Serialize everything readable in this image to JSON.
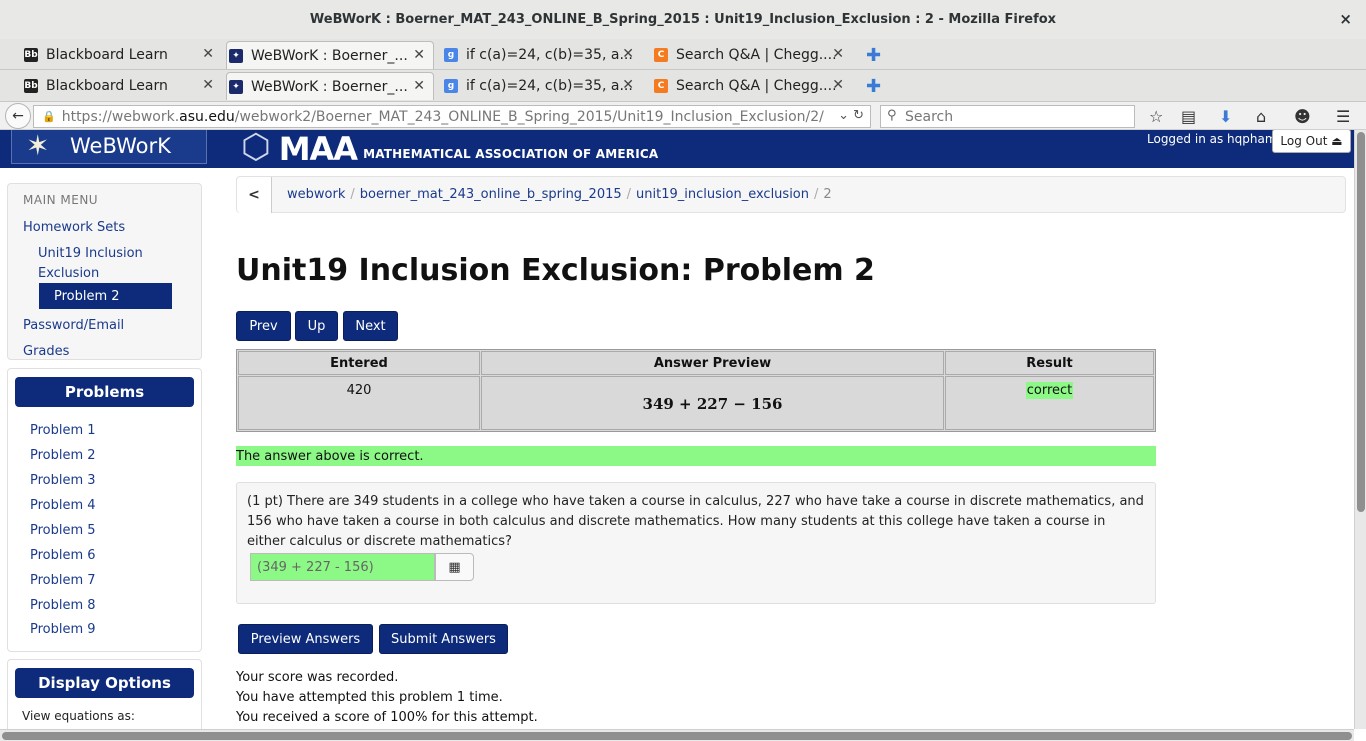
{
  "window": {
    "title": "WeBWorK : Boerner_MAT_243_ONLINE_B_Spring_2015 : Unit19_Inclusion_Exclusion : 2 - Mozilla Firefox",
    "close": "×"
  },
  "tabs": [
    {
      "label": "Blackboard Learn",
      "fav": "Bb"
    },
    {
      "label": "WeBWorK : Boerner_...",
      "fav": "✦"
    },
    {
      "label": "if c(a)=24, c(b)=35, a...",
      "fav": "g"
    },
    {
      "label": "Search Q&A | Chegg....",
      "fav": "C"
    }
  ],
  "nav": {
    "url_prefix": "https://webwork.",
    "url_host": "asu.edu",
    "url_path": "/webwork2/Boerner_MAT_243_ONLINE_B_Spring_2015/Unit19_Inclusion_Exclusion/2/",
    "search_placeholder": "Search"
  },
  "header": {
    "logo": "WeBWorK",
    "maa_big": "MAA",
    "maa_small": "MATHEMATICAL ASSOCIATION OF AMERICA",
    "logged_in": "Logged in as hqpham.",
    "logout": "Log Out"
  },
  "sidebar": {
    "main_menu": "MAIN MENU",
    "homework_sets": "Homework Sets",
    "set_line1": "Unit19 Inclusion",
    "set_line2": "Exclusion",
    "active_problem": "Problem 2",
    "password_email": "Password/Email",
    "grades": "Grades",
    "problems_title": "Problems",
    "problems": [
      "Problem 1",
      "Problem 2",
      "Problem 3",
      "Problem 4",
      "Problem 5",
      "Problem 6",
      "Problem 7",
      "Problem 8",
      "Problem 9"
    ],
    "display_title": "Display Options",
    "view_equations": "View equations as:"
  },
  "breadcrumb": {
    "back": "<",
    "items": [
      "webwork",
      "boerner_mat_243_online_b_spring_2015",
      "unit19_inclusion_exclusion"
    ],
    "current": "2",
    "sep": "/"
  },
  "main": {
    "title": "Unit19 Inclusion Exclusion: Problem 2",
    "prev": "Prev",
    "up": "Up",
    "next": "Next",
    "results": {
      "headers": [
        "Entered",
        "Answer Preview",
        "Result"
      ],
      "entered": "420",
      "preview": "349 + 227 − 156",
      "result": "correct"
    },
    "correct_message": "The answer above is correct.",
    "problem_text": "(1 pt) There are 349 students in a college who have taken a course in calculus, 227 who have take a course in discrete mathematics, and 156 who have taken a course in both calculus and discrete mathematics. How many students at this college have taken a course in either calculus or discrete mathematics?",
    "answer_value": "(349 + 227 - 156)",
    "preview_button": "Preview Answers",
    "submit_button": "Submit Answers",
    "score_recorded": "Your score was recorded.",
    "attempted": "You have attempted this problem 1 time.",
    "received": "You received a score of 100% for this attempt."
  },
  "colors": {
    "brand": "#0d2b7a",
    "correct": "#8cf987"
  }
}
